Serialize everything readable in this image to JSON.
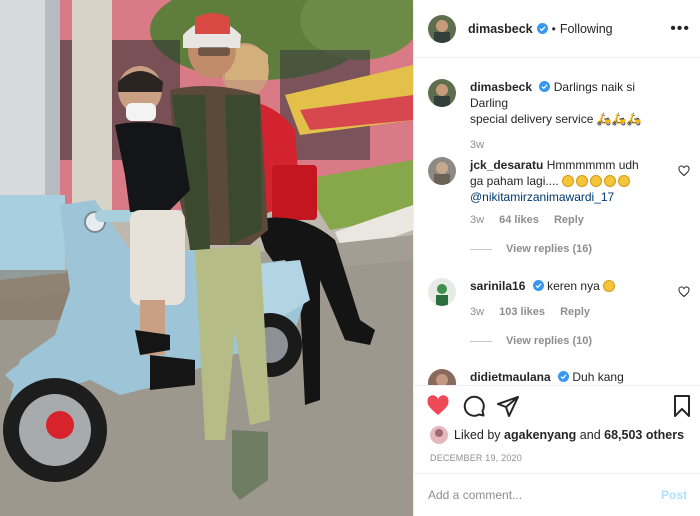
{
  "header": {
    "username": "dimasbeck",
    "following_label": "Following",
    "more_label": "•••"
  },
  "caption": {
    "username": "dimasbeck",
    "text": "Darlings naik si Darling",
    "text2": "special delivery service",
    "time": "3w"
  },
  "comments": [
    {
      "username": "jck_desaratu",
      "text": "Hmmmmmm udh",
      "text2": "ga paham lagi....",
      "mention": "@nikitamirzanimawardi_17",
      "time": "3w",
      "likes": "64 likes",
      "reply_label": "Reply",
      "replies_label": "View replies (16)"
    },
    {
      "username": "sarinila16",
      "text": "keren nya",
      "time": "3w",
      "likes": "103 likes",
      "reply_label": "Reply",
      "replies_label": "View replies (10)"
    },
    {
      "username": "didietmaulana",
      "text": "Duh kang"
    }
  ],
  "likes": {
    "prefix": "Liked by",
    "user": "agakenyang",
    "and": "and",
    "count": "68,503 others"
  },
  "date": "DECEMBER 19, 2020",
  "add_comment": {
    "placeholder": "Add a comment...",
    "post_label": "Post"
  },
  "colors": {
    "heart_red": "#ed4956",
    "verified_blue": "#3897f0",
    "post_disabled": "#b2dffc",
    "mention": "#00376b"
  }
}
